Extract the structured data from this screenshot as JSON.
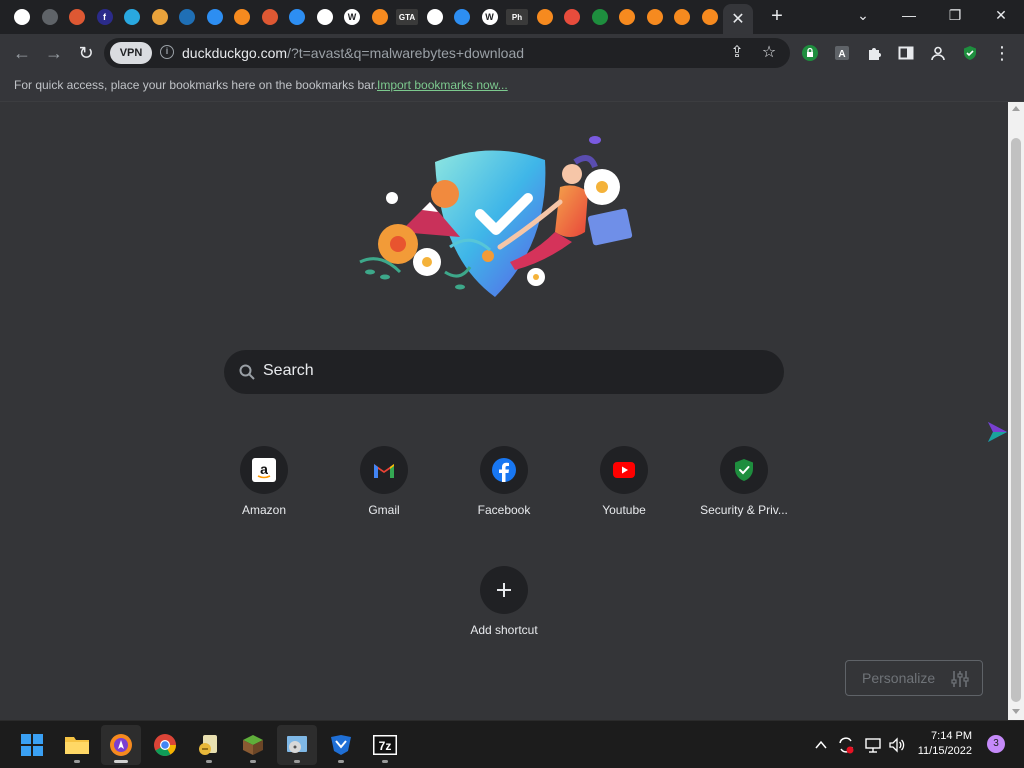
{
  "browser": {
    "active_tab_close": "✕",
    "new_tab": "+",
    "window_buttons": [
      "⌄",
      "—",
      "❐",
      "✕"
    ],
    "tab_favicons": [
      {
        "name": "globe",
        "color": "#ffffff",
        "glyph": ""
      },
      {
        "name": "cart",
        "color": "#5f6368",
        "glyph": ""
      },
      {
        "name": "duckduckgo",
        "color": "#de5833",
        "glyph": ""
      },
      {
        "name": "f-site",
        "color": "#2b2b8a",
        "glyph": "f"
      },
      {
        "name": "download-site",
        "color": "#29a8e0",
        "glyph": ""
      },
      {
        "name": "download-arrow",
        "color": "#e9a23b",
        "glyph": ""
      },
      {
        "name": "monitor-site",
        "color": "#1f6fb5",
        "glyph": ""
      },
      {
        "name": "malwarebytes",
        "color": "#2d8ef2",
        "glyph": ""
      },
      {
        "name": "avast",
        "color": "#f68a1f",
        "glyph": ""
      },
      {
        "name": "duckduckgo",
        "color": "#de5833",
        "glyph": ""
      },
      {
        "name": "loading",
        "color": "#2d8ef2",
        "glyph": ""
      },
      {
        "name": "globe",
        "color": "#ffffff",
        "glyph": ""
      },
      {
        "name": "wordpress",
        "color": "#ffffff",
        "glyph": "W"
      },
      {
        "name": "avast",
        "color": "#f68a1f",
        "glyph": ""
      },
      {
        "name": "gta",
        "color": "#3a3a3a",
        "glyph": "GTA"
      },
      {
        "name": "globe",
        "color": "#ffffff",
        "glyph": ""
      },
      {
        "name": "edge-site",
        "color": "#2d8ef2",
        "glyph": ""
      },
      {
        "name": "wordpress",
        "color": "#ffffff",
        "glyph": "W"
      },
      {
        "name": "ph-site",
        "color": "#3a3a3a",
        "glyph": "Ph"
      },
      {
        "name": "avast",
        "color": "#f68a1f",
        "glyph": ""
      },
      {
        "name": "red-site",
        "color": "#e74c3c",
        "glyph": ""
      },
      {
        "name": "shield-site",
        "color": "#1e8e3e",
        "glyph": ""
      },
      {
        "name": "avast",
        "color": "#f68a1f",
        "glyph": ""
      },
      {
        "name": "avast",
        "color": "#f68a1f",
        "glyph": ""
      },
      {
        "name": "avast",
        "color": "#f68a1f",
        "glyph": ""
      },
      {
        "name": "avast",
        "color": "#f68a1f",
        "glyph": ""
      }
    ]
  },
  "toolbar": {
    "back": "←",
    "forward": "→",
    "reload": "↻",
    "vpn_label": "VPN",
    "url_host": "duckduckgo.com",
    "url_path": "/?t=avast&q=malwarebytes+download",
    "share": "⇪",
    "star": "☆",
    "profile": "👤",
    "menu": "⋮"
  },
  "bookmarks_bar": {
    "hint": "For quick access, place your bookmarks here on the bookmarks bar.",
    "import_link": "Import bookmarks now..."
  },
  "newtab": {
    "search_placeholder": "Search",
    "shortcuts": [
      {
        "label": "Amazon",
        "icon": "amazon-icon"
      },
      {
        "label": "Gmail",
        "icon": "gmail-icon"
      },
      {
        "label": "Facebook",
        "icon": "facebook-icon"
      },
      {
        "label": "Youtube",
        "icon": "youtube-icon"
      },
      {
        "label": "Security & Priv...",
        "icon": "security-shield-icon"
      }
    ],
    "add_shortcut_label": "Add shortcut",
    "personalize_label": "Personalize"
  },
  "taskbar": {
    "time": "7:14 PM",
    "date": "11/15/2022",
    "notification_count": "3",
    "apps": [
      "start",
      "file-explorer",
      "avast-browser",
      "chrome",
      "script-editor",
      "minecraft",
      "installer",
      "malwarebytes",
      "7zip"
    ]
  },
  "colors": {
    "content_bg": "#343538",
    "toolbar_bg": "#35363a",
    "tabstrip_bg": "#202124",
    "link_green": "#7cc98e"
  }
}
